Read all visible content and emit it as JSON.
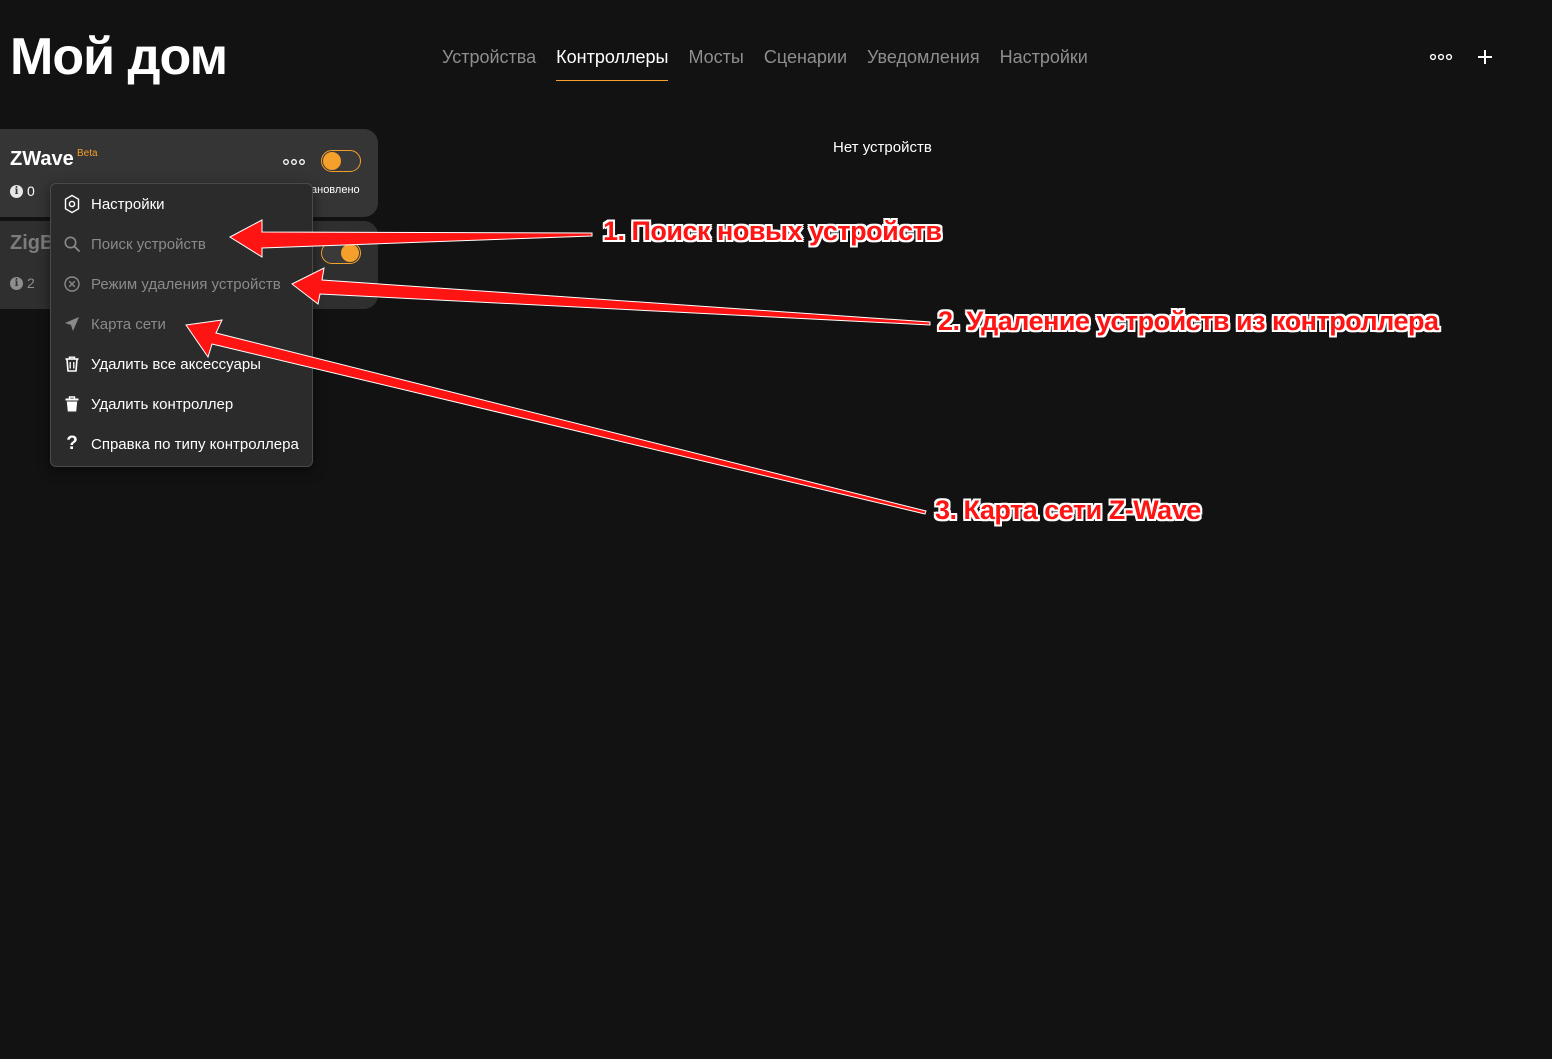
{
  "header": {
    "title": "Мой дом",
    "tabs": [
      {
        "label": "Устройства",
        "active": false
      },
      {
        "label": "Контроллеры",
        "active": true
      },
      {
        "label": "Мосты",
        "active": false
      },
      {
        "label": "Сценарии",
        "active": false
      },
      {
        "label": "Уведомления",
        "active": false
      },
      {
        "label": "Настройки",
        "active": false
      }
    ],
    "more_icon": "dots-horizontal-icon",
    "add_icon": "plus-icon",
    "add_label": "+"
  },
  "controllers": [
    {
      "name": "ZWave",
      "badge": "Beta",
      "info_count": "0",
      "status": "ановлено",
      "enabled": true
    },
    {
      "name": "ZigB",
      "info_count": "2",
      "status": "",
      "enabled": true
    }
  ],
  "context_menu": {
    "items": [
      {
        "label": "Настройки",
        "icon": "gear-icon",
        "disabled": false
      },
      {
        "label": "Поиск устройств",
        "icon": "search-icon",
        "disabled": true
      },
      {
        "label": "Режим удаления устройств",
        "icon": "close-circle-icon",
        "disabled": true
      },
      {
        "label": "Карта сети",
        "icon": "send-icon",
        "disabled": true
      },
      {
        "label": "Удалить все аксессуары",
        "icon": "trash-outline-icon",
        "disabled": false
      },
      {
        "label": "Удалить контроллер",
        "icon": "trash-icon",
        "disabled": false
      },
      {
        "label": "Справка по типу контроллера",
        "icon": "question-icon",
        "disabled": false
      }
    ]
  },
  "main": {
    "empty_text": "Нет устройств"
  },
  "annotations": {
    "a1": "1. Поиск новых устройств",
    "a2": "2. Удаление устройств из контроллера",
    "a3": "3. Карта сети Z-Wave"
  },
  "colors": {
    "background": "#121212",
    "accent": "#f5a02a",
    "annotation": "#ff1414"
  }
}
